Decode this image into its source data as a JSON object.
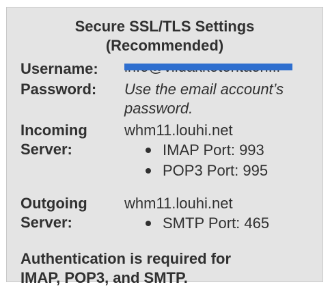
{
  "settings": {
    "title_line1": "Secure SSL/TLS Settings",
    "title_line2": "(Recommended)",
    "username_label": "Username:",
    "username_value": "info@viidakkotehtaeri.fi",
    "password_label": "Password:",
    "password_value_line1": "Use the email account’s",
    "password_value_line2": "password.",
    "incoming_label_line1": "Incoming",
    "incoming_label_line2": "Server:",
    "incoming_server": "whm11.louhi.net",
    "incoming_ports": [
      "IMAP Port: 993",
      "POP3 Port: 995"
    ],
    "outgoing_label_line1": "Outgoing",
    "outgoing_label_line2": "Server:",
    "outgoing_server": "whm11.louhi.net",
    "outgoing_ports": [
      "SMTP Port: 465"
    ],
    "auth_note_line1": "Authentication is required for",
    "auth_note_line2": "IMAP, POP3, and SMTP."
  },
  "colors": {
    "panel_background": "#e4e4e4",
    "text": "#303030",
    "redaction_bar": "#2f6fcf"
  }
}
